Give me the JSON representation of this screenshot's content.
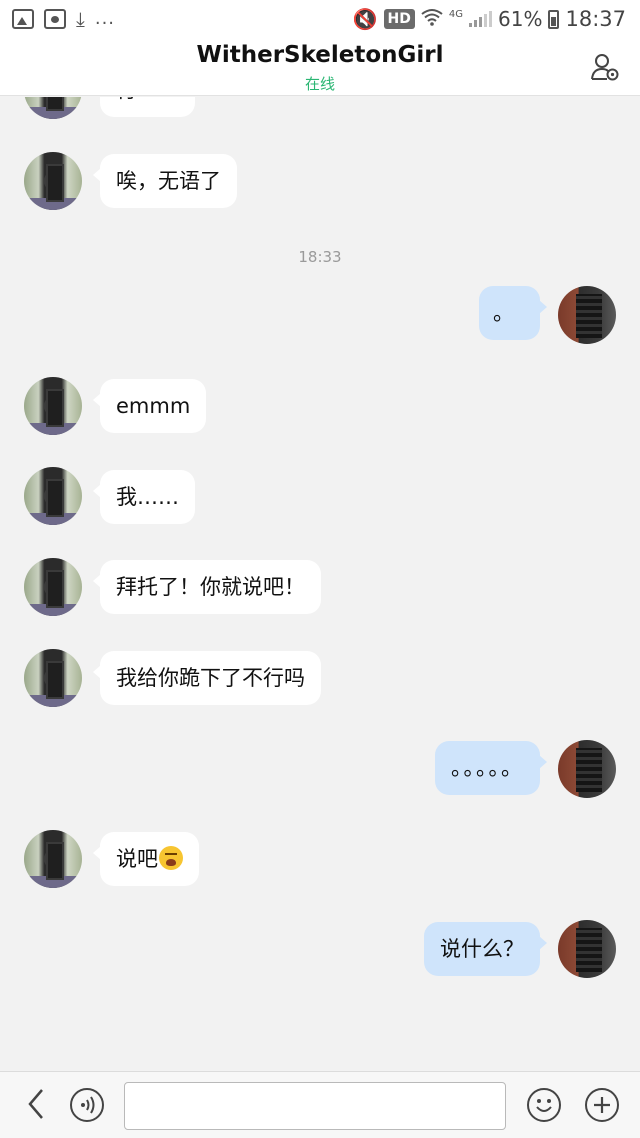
{
  "status_bar": {
    "left_icons": [
      "image-icon",
      "paw-icon",
      "download-icon",
      "more-icon"
    ],
    "more": "...",
    "hd": "HD",
    "network": "4G",
    "battery": "61%",
    "time": "18:37"
  },
  "header": {
    "title": "WitherSkeletonGirl",
    "status": "在线",
    "profile_icon": "profile-settings-icon"
  },
  "messages": [
    {
      "side": "in",
      "text": "行……"
    },
    {
      "side": "in",
      "text": "唉，无语了"
    },
    {
      "type": "time",
      "text": "18:33"
    },
    {
      "side": "out",
      "text": "。"
    },
    {
      "side": "in",
      "text": "emmm"
    },
    {
      "side": "in",
      "text": "我……"
    },
    {
      "side": "in",
      "text": "拜托了！你就说吧！"
    },
    {
      "side": "in",
      "text": "我给你跪下了不行吗"
    },
    {
      "side": "out",
      "text": "。。。。。"
    },
    {
      "side": "in",
      "text": "说吧",
      "emoji": "crying-emoji"
    },
    {
      "side": "out",
      "text": "说什么？"
    }
  ],
  "input_bar": {
    "back_icon": "back-chevron-icon",
    "voice_icon": "voice-icon",
    "input_value": "",
    "emoji_icon": "emoji-icon",
    "plus_icon": "plus-icon"
  },
  "colors": {
    "incoming_bubble": "#ffffff",
    "outgoing_bubble": "#cfe4fb",
    "online_status": "#2bb673",
    "background": "#f2f2f2"
  }
}
